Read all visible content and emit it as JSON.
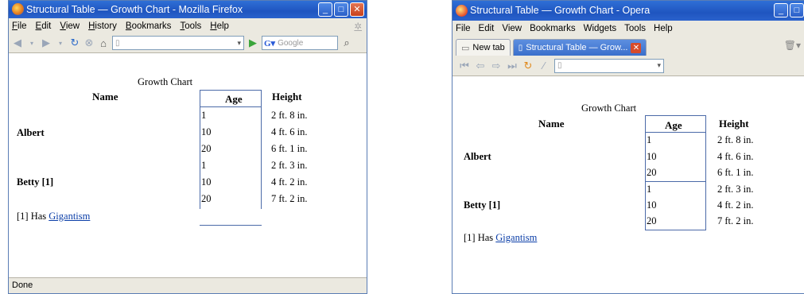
{
  "firefox": {
    "title": "Structural Table — Growth Chart - Mozilla Firefox",
    "menu": [
      "File",
      "Edit",
      "View",
      "History",
      "Bookmarks",
      "Tools",
      "Help"
    ],
    "search_placeholder": "Google",
    "status": "Done"
  },
  "opera": {
    "title": "Structural Table — Growth Chart - Opera",
    "menu": [
      "File",
      "Edit",
      "View",
      "Bookmarks",
      "Widgets",
      "Tools",
      "Help"
    ],
    "tabs": [
      "New tab",
      "Structural Table — Grow..."
    ]
  },
  "table": {
    "caption": "Growth Chart",
    "headers": [
      "Name",
      "Age",
      "Height"
    ],
    "groups": [
      {
        "name": "Albert",
        "rows": [
          {
            "age": "1",
            "height": "2 ft. 8 in."
          },
          {
            "age": "10",
            "height": "4 ft. 6 in."
          },
          {
            "age": "20",
            "height": "6 ft. 1 in."
          }
        ]
      },
      {
        "name": "Betty [1]",
        "rows": [
          {
            "age": "1",
            "height": "2 ft. 3 in."
          },
          {
            "age": "10",
            "height": "4 ft. 2 in."
          },
          {
            "age": "20",
            "height": "7 ft. 2 in."
          }
        ]
      }
    ],
    "footnote_prefix": "[1] Has",
    "footnote_link": "Gigantism"
  }
}
